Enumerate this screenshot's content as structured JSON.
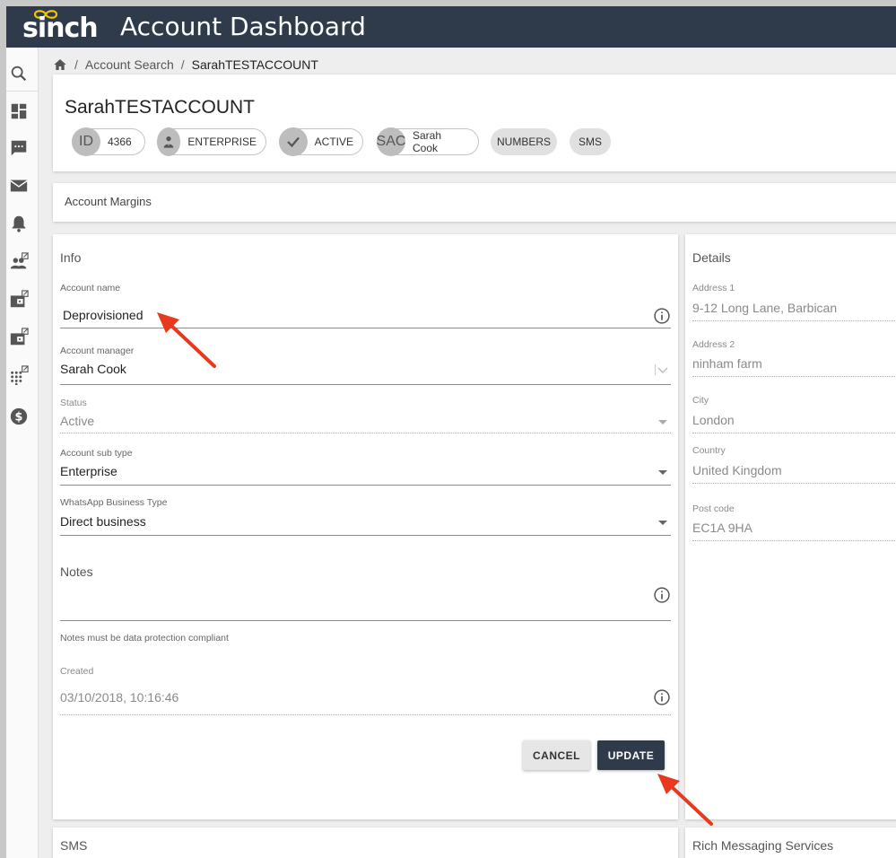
{
  "app": {
    "logo": "sinch",
    "title": "Account Dashboard"
  },
  "sidebar": [
    {
      "icon": "search-icon"
    },
    {
      "icon": "dashboard-icon"
    },
    {
      "icon": "chat-icon"
    },
    {
      "icon": "mail-icon"
    },
    {
      "icon": "bell-icon"
    },
    {
      "icon": "people-external-icon"
    },
    {
      "icon": "wallet-external-icon"
    },
    {
      "icon": "wallet-external-icon"
    },
    {
      "icon": "dialpad-external-icon"
    },
    {
      "icon": "dollar-icon"
    }
  ],
  "breadcrumb": {
    "home_icon": "home-icon",
    "sep": "/",
    "parent": "Account Search",
    "current": "SarahTESTACCOUNT"
  },
  "account": {
    "name": "SarahTESTACCOUNT",
    "chips": {
      "id_avatar": "ID",
      "id_value": "4366",
      "type": "ENTERPRISE",
      "status": "ACTIVE",
      "manager_avatar": "SAC",
      "manager": "Sarah Cook",
      "numbers": "NUMBERS",
      "sms": "SMS"
    }
  },
  "margins": {
    "title": "Account Margins"
  },
  "info": {
    "title": "Info",
    "account_name": {
      "label": "Account name",
      "value": "Deprovisioned"
    },
    "account_manager": {
      "label": "Account manager",
      "value": "Sarah Cook"
    },
    "status": {
      "label": "Status",
      "value": "Active"
    },
    "sub_type": {
      "label": "Account sub type",
      "value": "Enterprise"
    },
    "whatsapp": {
      "label": "WhatsApp Business Type",
      "value": "Direct business"
    },
    "notes": {
      "label": "Notes",
      "value": "",
      "hint": "Notes must be data protection compliant"
    },
    "created": {
      "label": "Created",
      "value": "03/10/2018, 10:16:46"
    },
    "cancel_label": "CANCEL",
    "update_label": "UPDATE"
  },
  "details": {
    "title": "Details",
    "address1": {
      "label": "Address 1",
      "value": "9-12 Long Lane, Barbican"
    },
    "address2": {
      "label": "Address 2",
      "value": "ninham farm"
    },
    "city": {
      "label": "City",
      "value": "London"
    },
    "country": {
      "label": "Country",
      "value": "United Kingdom"
    },
    "postcode": {
      "label": "Post code",
      "value": "EC1A 9HA"
    }
  },
  "bottom": {
    "sms": "SMS",
    "rms": "Rich Messaging Services"
  },
  "colors": {
    "topbar": "#2f3b4a",
    "annotation_arrow": "#e8391e",
    "update_button": "#2f3b4a"
  }
}
